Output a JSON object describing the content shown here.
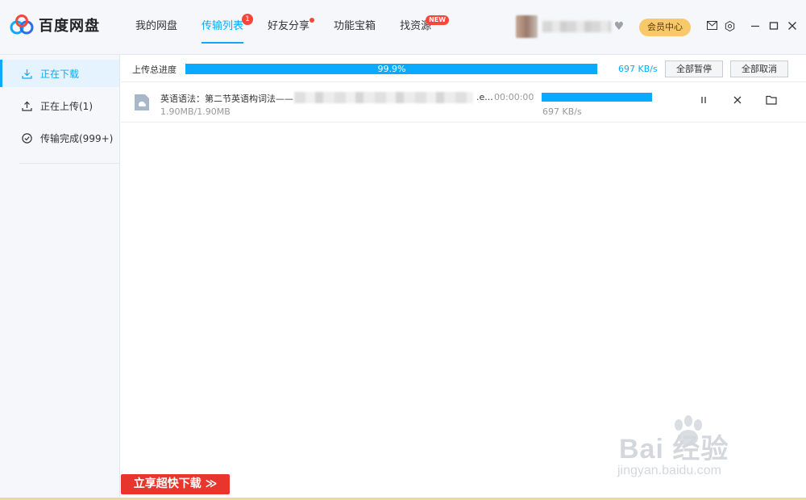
{
  "app": {
    "title": "百度网盘"
  },
  "nav": {
    "items": [
      {
        "label": "我的网盘"
      },
      {
        "label": "传输列表",
        "badge": "1"
      },
      {
        "label": "好友分享"
      },
      {
        "label": "功能宝箱"
      },
      {
        "label": "找资源",
        "badge": "NEW"
      }
    ]
  },
  "header": {
    "vip_label": "会员中心"
  },
  "sidebar": {
    "items": [
      {
        "label": "正在下载"
      },
      {
        "label": "正在上传(1)"
      },
      {
        "label": "传输完成(999+)"
      }
    ]
  },
  "summary": {
    "label": "上传总进度",
    "progress": 99.9,
    "percent_text": "99.9%",
    "speed": "697 KB/s",
    "pause_all": "全部暂停",
    "cancel_all": "全部取消"
  },
  "tasks": [
    {
      "name": "英语语法：第二节英语构词法——",
      "ext": ".e...",
      "size": "1.90MB/1.90MB",
      "time": "00:00:00",
      "progress": 100,
      "speed": "697 KB/s"
    }
  ],
  "promo": {
    "label": "立享超快下载 ≫"
  },
  "watermark": {
    "main": "Bai 经验",
    "sub": "jingyan.baidu.com"
  },
  "colors": {
    "accent": "#09aaff",
    "badge": "#f5483b",
    "vip": "#f8c96a",
    "promo": "#e8352d"
  }
}
